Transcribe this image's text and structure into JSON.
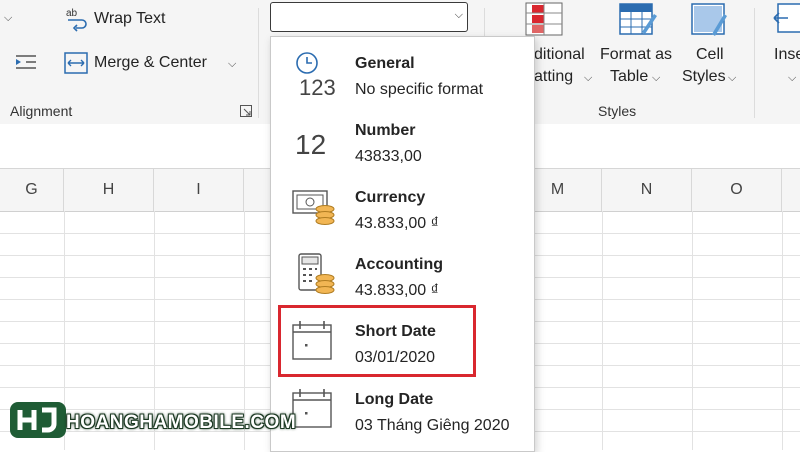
{
  "ribbon": {
    "wrap_text": "Wrap Text",
    "merge_center": "Merge & Center",
    "alignment_group": "Alignment",
    "conditional_line1": "ditional",
    "conditional_line2": "atting",
    "format_table_line1": "Format as",
    "format_table_line2": "Table",
    "cell_styles_line1": "Cell",
    "cell_styles_line2": "Styles",
    "styles_group": "Styles",
    "insert_partial": "Inse"
  },
  "number_format_box": {
    "value": ""
  },
  "columns": [
    "G",
    "H",
    "I",
    "M",
    "N",
    "O"
  ],
  "format_menu": {
    "items": [
      {
        "name": "General",
        "example": "No specific format",
        "icon": "clock-123-icon"
      },
      {
        "name": "Number",
        "example": "43833,00",
        "icon": "number-12-icon"
      },
      {
        "name": "Currency",
        "example": "43.833,00 ₫",
        "icon": "currency-icon"
      },
      {
        "name": "Accounting",
        "example": " 43.833,00 ₫",
        "icon": "accounting-icon"
      },
      {
        "name": "Short Date",
        "example": "03/01/2020",
        "icon": "calendar-icon"
      },
      {
        "name": "Long Date",
        "example": "03 Tháng Giêng 2020",
        "icon": "calendar-icon"
      }
    ],
    "icon_text_general": "123",
    "icon_text_number": "12",
    "highlighted": "Short Date"
  },
  "watermark": {
    "text": "HOANGHAMOBILE.COM"
  },
  "colors": {
    "highlight": "#d9272f",
    "ribbon_bg": "#f5f5f5",
    "brand_green": "#2e7d4f"
  }
}
